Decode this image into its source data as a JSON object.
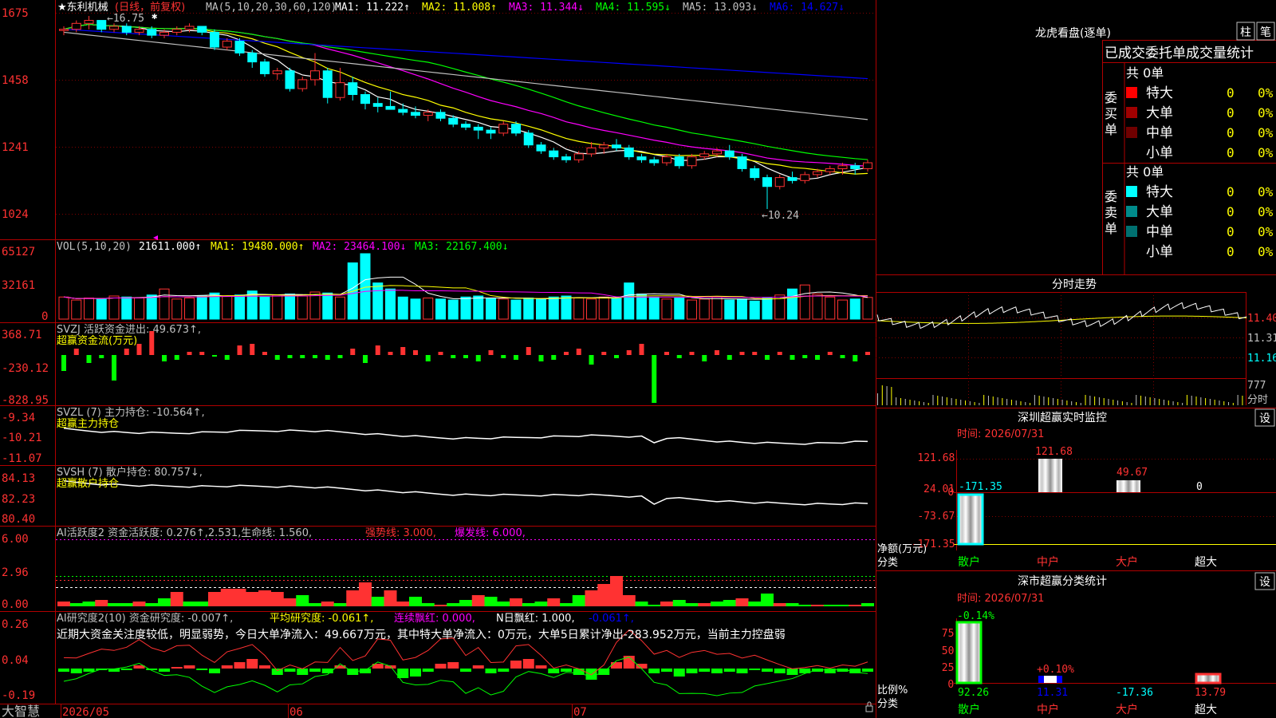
{
  "colors": {
    "up": "#ff3232",
    "down": "#00ffff",
    "grid": "#b00000",
    "ma1": "#ffffff",
    "ma2": "#ffff00",
    "ma3": "#ff00ff",
    "ma4": "#00ff00",
    "ma5": "#c0c0c0",
    "ma6": "#0000ff"
  },
  "price_panel": {
    "stock_name": "★东利机械",
    "period": "(日线，前复权)",
    "ma_label": "MA(5,10,20,30,60,120)",
    "ma_values": [
      {
        "text": "MA1: 11.222↑",
        "color": "#ffffff"
      },
      {
        "text": "MA2: 11.008↑",
        "color": "#ffff00"
      },
      {
        "text": "MA3: 11.344↓",
        "color": "#ff00ff"
      },
      {
        "text": "MA4: 11.595↓",
        "color": "#00ff00"
      },
      {
        "text": "MA5: 13.093↓",
        "color": "#c0c0c0"
      },
      {
        "text": "MA6: 14.627↓",
        "color": "#0000ff"
      }
    ],
    "y_ticks": [
      "1675",
      "1458",
      "1241",
      "1024"
    ],
    "high_note": "←16.75",
    "low_note": "←10.24"
  },
  "vol_panel": {
    "label": "VOL(5,10,20)",
    "value": "21611.000↑",
    "ma_values": [
      {
        "text": "MA1: 19480.000↑",
        "color": "#ffff00"
      },
      {
        "text": "MA2: 23464.100↓",
        "color": "#ff00ff"
      },
      {
        "text": "MA3: 22167.400↓",
        "color": "#00ff00"
      }
    ],
    "y_ticks": [
      "65127",
      "32161",
      "0"
    ]
  },
  "svzj_panel": {
    "label": "SVZJ  活跃资金进出: 49.673↑,",
    "sub": "超赢资金流(万元)",
    "y_ticks": [
      "368.71",
      "-230.12",
      "-828.95"
    ]
  },
  "svzl_panel": {
    "label": "SVZL (7) 主力持仓: -10.564↑,",
    "sub": "超赢主力持仓",
    "y_ticks": [
      "-9.34",
      "-10.21",
      "-11.07"
    ]
  },
  "svsh_panel": {
    "label": "SVSH (7) 散户持仓: 80.757↓,",
    "sub": "超赢散户持仓",
    "y_ticks": [
      "84.13",
      "82.23",
      "80.40"
    ]
  },
  "ai1_panel": {
    "label_a": "AI活跃度2 资金活跃度: 0.276↑,2.531,生命线: 1.560,",
    "label_b": "强势线: 3.000,",
    "label_c": "爆发线: 6.000,",
    "y_ticks": [
      "6.00",
      "2.96",
      "0.00"
    ]
  },
  "ai2_panel": {
    "label_a": "AI研究度2(10) 资金研究度: -0.007↑,",
    "label_b": "平均研究度: -0.061↑,",
    "label_c": "连续飘红: 0.000,",
    "label_d": "N日飘红: 1.000,",
    "label_e": "-0.061↑,",
    "comment": "近期大资金关注度较低，明显弱势，今日大单净流入：49.667万元，其中特大单净流入：0万元，大单5日累计净出-283.952万元，当前主力控盘弱",
    "y_ticks": [
      "0.26",
      "0.04",
      "-0.19"
    ]
  },
  "date_axis": {
    "logo": "大智慧",
    "labels": [
      "2026/05",
      "06",
      "07"
    ]
  },
  "order_panel": {
    "title": "龙虎看盘(逐单)",
    "btn_zhu": "柱",
    "btn_bi": "笔",
    "header": "已成交委托单成交量统计",
    "buy_label": "委买单",
    "sell_label": "委卖单",
    "buy_total": "共 0单",
    "sell_total": "共 0单",
    "buy_rows": [
      {
        "name": "特大",
        "count": "0",
        "pct": "0%",
        "color": "#ff0000"
      },
      {
        "name": "大单",
        "count": "0",
        "pct": "0%",
        "color": "#a00000"
      },
      {
        "name": "中单",
        "count": "0",
        "pct": "0%",
        "color": "#700000"
      },
      {
        "name": "小单",
        "count": "0",
        "pct": "0%",
        "color": ""
      }
    ],
    "sell_rows": [
      {
        "name": "特大",
        "count": "0",
        "pct": "0%",
        "color": "#00ffff"
      },
      {
        "name": "大单",
        "count": "0",
        "pct": "0%",
        "color": "#008b8b"
      },
      {
        "name": "中单",
        "count": "0",
        "pct": "0%",
        "color": "#007070"
      },
      {
        "name": "小单",
        "count": "0",
        "pct": "0%",
        "color": ""
      }
    ]
  },
  "intraday_panel": {
    "title": "分时走势",
    "y_ticks": [
      "11.40",
      "11.31",
      "11.16"
    ],
    "vol_tick": "777",
    "vol_label": "分时"
  },
  "monitor_panel": {
    "title": "深圳超赢实时监控",
    "btn": "设",
    "time": "时间: 2026/07/31",
    "y_ticks": [
      "121.68",
      "24.01",
      "0",
      "-73.67",
      "-171.35"
    ],
    "unit_label": "净额(万元)",
    "cat_label": "分类",
    "categories": [
      "散户",
      "中户",
      "大户",
      "超大"
    ],
    "values": [
      "-171.35",
      "121.68",
      "49.67",
      "0"
    ]
  },
  "stats_panel": {
    "title": "深市超赢分类统计",
    "btn": "设",
    "time": "时间: 2026/07/31",
    "y_ticks": [
      "75",
      "50",
      "25",
      "0"
    ],
    "ratio_label": "比例%",
    "cat_label": "分类",
    "top_labels": [
      "-0.14%",
      "+0.10%"
    ],
    "values": [
      "92.26",
      "11.31",
      "-17.36",
      "13.79"
    ],
    "categories": [
      "散户",
      "中户",
      "大户",
      "超大"
    ]
  },
  "chart_data": [
    {
      "type": "candlestick",
      "title": "东利机械 (日线，前复权)",
      "x_labels": [
        "2026/05",
        "06",
        "07"
      ],
      "ylim": [
        10.24,
        16.75
      ],
      "annotations": [
        "←16.75",
        "←10.24"
      ],
      "ohlc": [
        [
          16.3,
          16.4,
          16.1,
          16.3
        ],
        [
          16.3,
          16.6,
          16.2,
          16.5
        ],
        [
          16.5,
          16.75,
          16.3,
          16.6
        ],
        [
          16.6,
          16.6,
          16.2,
          16.3
        ],
        [
          16.3,
          16.5,
          16.2,
          16.4
        ],
        [
          16.4,
          16.5,
          16.1,
          16.2
        ],
        [
          16.2,
          16.4,
          16.1,
          16.3
        ],
        [
          16.3,
          16.4,
          16.0,
          16.1
        ],
        [
          16.1,
          16.3,
          16.0,
          16.2
        ],
        [
          16.2,
          16.4,
          16.1,
          16.3
        ],
        [
          16.3,
          16.5,
          16.2,
          16.4
        ],
        [
          16.4,
          16.4,
          16.1,
          16.2
        ],
        [
          16.2,
          16.3,
          15.6,
          15.7
        ],
        [
          15.7,
          16.0,
          15.6,
          15.9
        ],
        [
          15.9,
          16.0,
          15.4,
          15.5
        ],
        [
          15.5,
          15.6,
          15.0,
          15.2
        ],
        [
          15.2,
          15.3,
          14.7,
          14.8
        ],
        [
          14.8,
          15.0,
          14.6,
          14.9
        ],
        [
          14.9,
          15.0,
          14.2,
          14.3
        ],
        [
          14.3,
          14.7,
          14.2,
          14.6
        ],
        [
          14.6,
          15.5,
          14.4,
          14.9
        ],
        [
          14.9,
          15.0,
          13.8,
          14.0
        ],
        [
          14.0,
          15.0,
          13.9,
          14.5
        ],
        [
          14.5,
          14.7,
          13.9,
          14.1
        ],
        [
          14.1,
          14.2,
          13.6,
          13.8
        ],
        [
          13.8,
          14.0,
          13.5,
          13.7
        ],
        [
          13.7,
          14.2,
          13.6,
          13.6
        ],
        [
          13.6,
          13.8,
          13.4,
          13.5
        ],
        [
          13.5,
          13.7,
          13.3,
          13.4
        ],
        [
          13.4,
          13.6,
          13.2,
          13.5
        ],
        [
          13.5,
          13.6,
          13.2,
          13.3
        ],
        [
          13.3,
          13.4,
          13.0,
          13.1
        ],
        [
          13.1,
          13.2,
          12.9,
          13.0
        ],
        [
          13.0,
          13.1,
          12.6,
          12.9
        ],
        [
          12.9,
          13.0,
          12.6,
          12.8
        ],
        [
          12.8,
          13.2,
          12.7,
          13.1
        ],
        [
          13.1,
          13.2,
          12.7,
          12.8
        ],
        [
          12.8,
          12.9,
          12.3,
          12.4
        ],
        [
          12.4,
          12.5,
          12.1,
          12.2
        ],
        [
          12.2,
          12.3,
          11.9,
          12.0
        ],
        [
          12.0,
          12.1,
          11.8,
          11.9
        ],
        [
          11.9,
          12.2,
          11.8,
          12.1
        ],
        [
          12.1,
          12.5,
          12.0,
          12.3
        ],
        [
          12.3,
          12.5,
          12.1,
          12.4
        ],
        [
          12.4,
          12.6,
          12.2,
          12.3
        ],
        [
          12.3,
          12.4,
          11.9,
          12.0
        ],
        [
          12.0,
          12.1,
          11.8,
          11.9
        ],
        [
          11.9,
          12.0,
          11.7,
          11.8
        ],
        [
          11.8,
          12.1,
          11.7,
          12.0
        ],
        [
          12.0,
          12.1,
          11.6,
          11.7
        ],
        [
          11.7,
          12.1,
          11.6,
          12.0
        ],
        [
          12.0,
          12.2,
          11.9,
          12.1
        ],
        [
          12.1,
          12.3,
          12.0,
          12.2
        ],
        [
          12.2,
          12.4,
          11.9,
          12.0
        ],
        [
          12.0,
          12.1,
          11.5,
          11.6
        ],
        [
          11.6,
          11.7,
          11.2,
          11.3
        ],
        [
          11.3,
          11.4,
          10.24,
          11.0
        ],
        [
          11.0,
          11.4,
          10.9,
          11.3
        ],
        [
          11.3,
          11.5,
          11.1,
          11.2
        ],
        [
          11.2,
          11.5,
          11.1,
          11.4
        ],
        [
          11.4,
          11.6,
          11.3,
          11.5
        ],
        [
          11.5,
          11.7,
          11.4,
          11.6
        ],
        [
          11.6,
          11.8,
          11.4,
          11.7
        ],
        [
          11.7,
          11.8,
          11.4,
          11.6
        ],
        [
          11.6,
          11.9,
          11.5,
          11.8
        ]
      ],
      "ma_lines": [
        "MA1",
        "MA2",
        "MA3",
        "MA4",
        "MA5",
        "MA6"
      ]
    },
    {
      "type": "bar",
      "title": "VOL(5,10,20)",
      "ylim": [
        0,
        65127
      ],
      "values": [
        22000,
        19000,
        21000,
        20000,
        23000,
        22000,
        21000,
        24000,
        30000,
        20000,
        21000,
        23000,
        26000,
        23000,
        24000,
        28000,
        22000,
        24000,
        25000,
        23000,
        27000,
        26000,
        22000,
        56000,
        65127,
        36000,
        30000,
        22000,
        20000,
        21000,
        20000,
        19000,
        22000,
        23000,
        21000,
        20000,
        19000,
        21000,
        20000,
        22000,
        23000,
        21000,
        20000,
        22000,
        21000,
        36000,
        25000,
        22000,
        20000,
        21000,
        19000,
        20000,
        22000,
        19000,
        20000,
        18000,
        21000,
        24000,
        30000,
        34000,
        25000,
        22000,
        19000,
        20000,
        21611
      ]
    }
  ]
}
